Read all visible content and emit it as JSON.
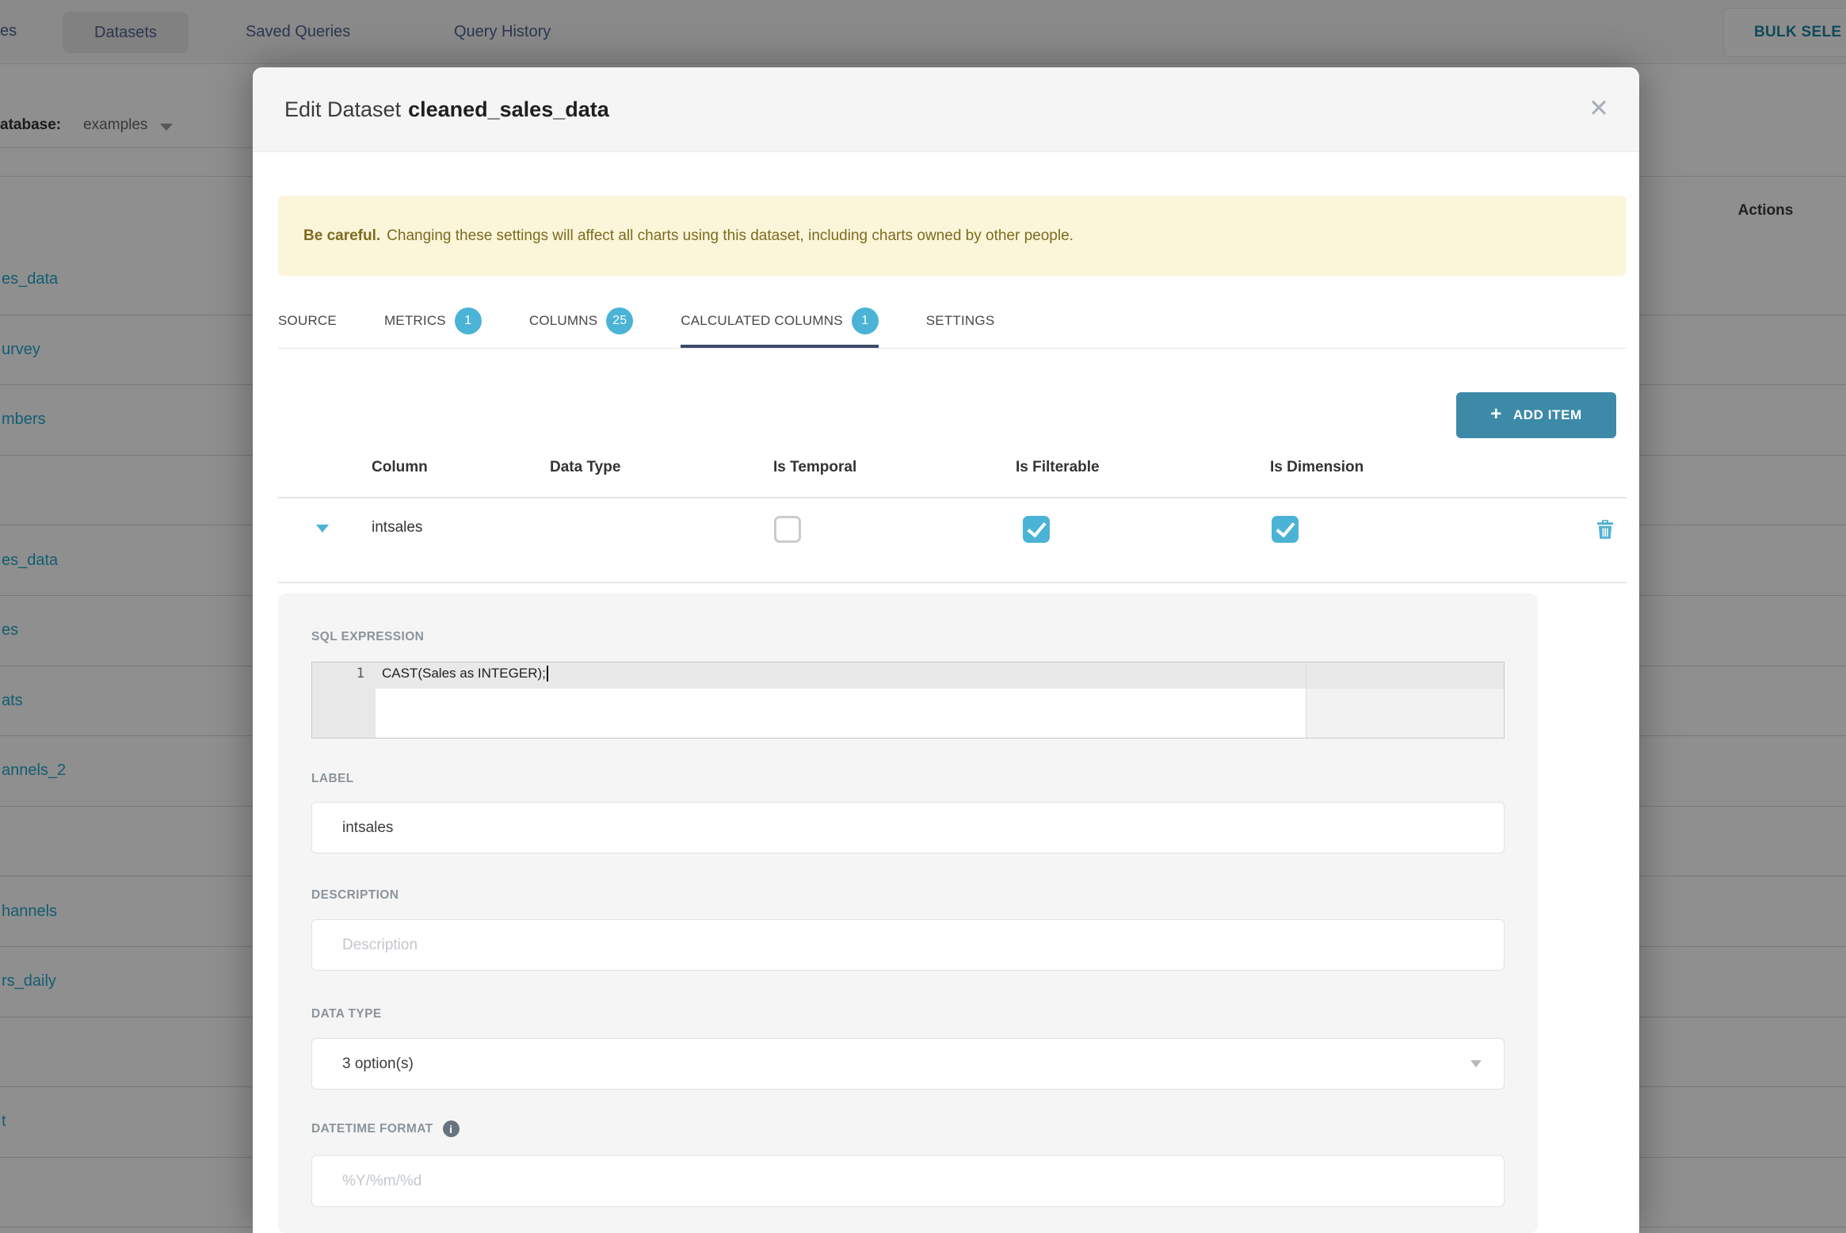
{
  "background": {
    "nav": {
      "left_fragment": "es",
      "tabs": [
        {
          "label": "Datasets",
          "active": true
        },
        {
          "label": "Saved Queries",
          "active": false
        },
        {
          "label": "Query History",
          "active": false
        }
      ],
      "bulk_select_label": "BULK SELE"
    },
    "toolbar": {
      "label": "atabase:",
      "value": "examples"
    },
    "table": {
      "actions_header": "Actions",
      "rows": [
        "es_data",
        "urvey",
        "mbers",
        "",
        "es_data",
        "es",
        "ats",
        "annels_2",
        "",
        "hannels",
        "rs_daily",
        "",
        "t",
        ""
      ]
    }
  },
  "modal": {
    "title_prefix": "Edit Dataset",
    "title_name": "cleaned_sales_data",
    "close_icon": "✕",
    "warning": {
      "bold": "Be careful.",
      "text": "Changing these settings will affect all charts using this dataset, including charts owned by other people."
    },
    "tabs": [
      {
        "label": "SOURCE",
        "badge": "",
        "active": false
      },
      {
        "label": "METRICS",
        "badge": "1",
        "active": false
      },
      {
        "label": "COLUMNS",
        "badge": "25",
        "active": false
      },
      {
        "label": "CALCULATED COLUMNS",
        "badge": "1",
        "active": true
      },
      {
        "label": "SETTINGS",
        "badge": "",
        "active": false
      }
    ],
    "add_item": {
      "plus": "+",
      "label": "ADD ITEM"
    },
    "columns_table": {
      "headers": [
        "Column",
        "Data Type",
        "Is Temporal",
        "Is Filterable",
        "Is Dimension"
      ],
      "row": {
        "name": "intsales",
        "checks": [
          {
            "name": "is-temporal",
            "checked": false
          },
          {
            "name": "is-filterable",
            "checked": true
          },
          {
            "name": "is-dimension",
            "checked": true
          }
        ]
      }
    },
    "detail": {
      "sql_label": "SQL EXPRESSION",
      "sql_line_number": "1",
      "sql_code": "CAST(Sales as INTEGER);",
      "label_label": "LABEL",
      "label_value": "intsales",
      "description_label": "DESCRIPTION",
      "description_placeholder": "Description",
      "datatype_label": "DATA TYPE",
      "datatype_value": "3 option(s)",
      "datetime_label": "DATETIME FORMAT",
      "datetime_placeholder": "%Y/%m/%d",
      "info_icon": "i"
    }
  },
  "colors": {
    "link_teal": "#20a7c9",
    "badge_cyan": "#4ab3d6",
    "add_button_teal": "#3d8aa8",
    "icon_cyan": "#51b1d4",
    "warning_bg": "#fbf5da",
    "warning_text": "#7b6c1f",
    "tab_underline": "#3e4b68"
  }
}
